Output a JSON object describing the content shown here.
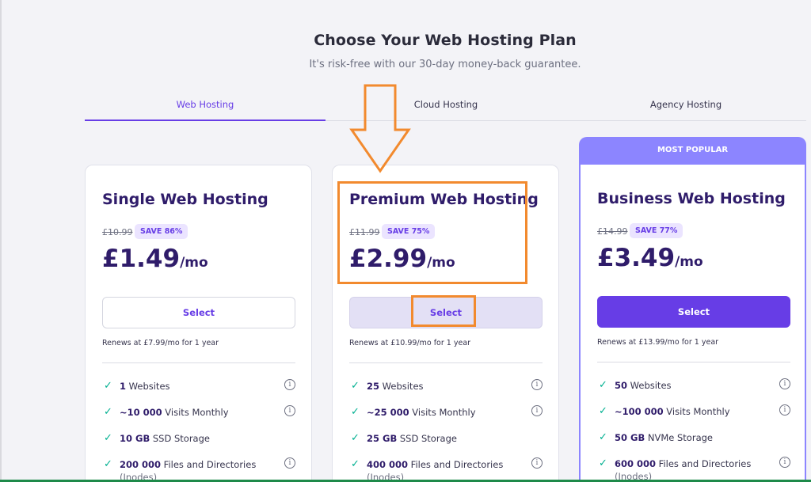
{
  "header": {
    "title": "Choose Your Web Hosting Plan",
    "subtitle": "It's risk-free with our 30-day money-back guarantee."
  },
  "tabs": [
    {
      "label": "Web Hosting",
      "active": true
    },
    {
      "label": "Cloud Hosting",
      "active": false
    },
    {
      "label": "Agency Hosting",
      "active": false
    }
  ],
  "popular_label": "MOST POPULAR",
  "plans": [
    {
      "name": "Single Web Hosting",
      "old_price": "£10.99",
      "save": "SAVE 86%",
      "price": "£1.49",
      "per": "/mo",
      "button": "Select",
      "renews": "Renews at £7.99/mo for 1 year",
      "features": [
        {
          "bold": "1",
          "text": " Websites"
        },
        {
          "bold": "~10 000",
          "text": " Visits Monthly"
        },
        {
          "bold": "10 GB",
          "text": " SSD Storage"
        },
        {
          "bold": "200 000",
          "text": " Files and Directories",
          "sub": "(Inodes)"
        }
      ]
    },
    {
      "name": "Premium Web Hosting",
      "old_price": "£11.99",
      "save": "SAVE 75%",
      "price": "£2.99",
      "per": "/mo",
      "button": "Select",
      "renews": "Renews at £10.99/mo for 1 year",
      "features": [
        {
          "bold": "25",
          "text": " Websites"
        },
        {
          "bold": "~25 000",
          "text": " Visits Monthly"
        },
        {
          "bold": "25 GB",
          "text": " SSD Storage"
        },
        {
          "bold": "400 000",
          "text": " Files and Directories",
          "sub": "(Inodes)"
        }
      ]
    },
    {
      "name": "Business Web Hosting",
      "old_price": "£14.99",
      "save": "SAVE 77%",
      "price": "£3.49",
      "per": "/mo",
      "button": "Select",
      "renews": "Renews at £13.99/mo for 1 year",
      "features": [
        {
          "bold": "50",
          "text": " Websites"
        },
        {
          "bold": "~100 000",
          "text": " Visits Monthly"
        },
        {
          "bold": "50 GB",
          "text": " NVMe Storage"
        },
        {
          "bold": "600 000",
          "text": " Files and Directories",
          "sub": "(Inodes)"
        }
      ]
    }
  ],
  "icons": {
    "check": "check-icon",
    "info": "info-icon"
  },
  "colors": {
    "accent": "#673de6",
    "popular": "#8c85ff",
    "annotation": "#f28a2e",
    "check": "#00b090"
  }
}
